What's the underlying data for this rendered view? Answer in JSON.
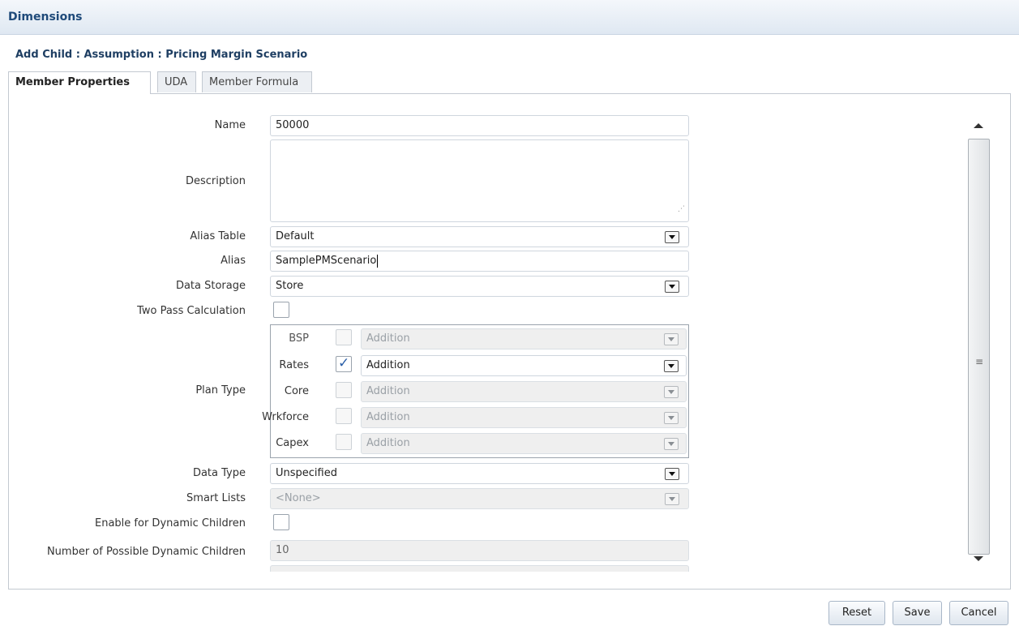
{
  "header": {
    "title": "Dimensions"
  },
  "subtitle": "Add Child : Assumption : Pricing Margin Scenario",
  "tabs": [
    {
      "label": "Member Properties",
      "active": true
    },
    {
      "label": "UDA",
      "active": false
    },
    {
      "label": "Member Formula",
      "active": false
    }
  ],
  "form": {
    "name": {
      "label": "Name",
      "value": "50000"
    },
    "description": {
      "label": "Description",
      "value": ""
    },
    "alias_table": {
      "label": "Alias Table",
      "value": "Default"
    },
    "alias": {
      "label": "Alias",
      "value": "SamplePMScenario"
    },
    "data_storage": {
      "label": "Data Storage",
      "value": "Store"
    },
    "two_pass": {
      "label": "Two Pass Calculation",
      "checked": false
    },
    "plan_type": {
      "label": "Plan Type",
      "rows": [
        {
          "label": "BSP",
          "checked": false,
          "value": "Addition",
          "enabled": false
        },
        {
          "label": "Rates",
          "checked": true,
          "value": "Addition",
          "enabled": true
        },
        {
          "label": "Core",
          "checked": false,
          "value": "Addition",
          "enabled": false
        },
        {
          "label": "Wrkforce",
          "checked": false,
          "value": "Addition",
          "enabled": false
        },
        {
          "label": "Capex",
          "checked": false,
          "value": "Addition",
          "enabled": false
        }
      ]
    },
    "data_type": {
      "label": "Data Type",
      "value": "Unspecified"
    },
    "smart_lists": {
      "label": "Smart Lists",
      "value": "<None>"
    },
    "dynamic_children": {
      "label": "Enable for Dynamic Children",
      "checked": false
    },
    "num_dynamic_children": {
      "label": "Number of Possible Dynamic Children",
      "value": "10"
    }
  },
  "buttons": {
    "reset": "Reset",
    "save": "Save",
    "cancel": "Cancel"
  },
  "colors": {
    "header_text": "#1f4a7a",
    "check": "#2b5fa8"
  }
}
